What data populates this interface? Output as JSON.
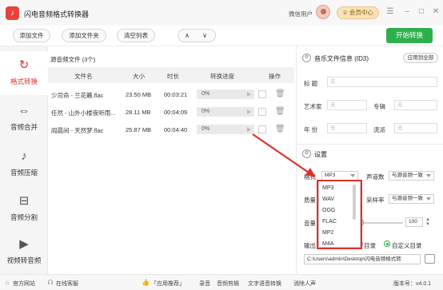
{
  "app": {
    "title": "闪电音频格式转换器",
    "logo_glyph": "♪"
  },
  "topbar": {
    "user_label": "微信用户",
    "vip_label": "会员中心",
    "window_icons": [
      "menu-icon",
      "minimize-icon",
      "maximize-icon",
      "close-icon"
    ]
  },
  "toolbar": {
    "add_file": "添加文件",
    "add_folder": "添加文件夹",
    "clear_list": "清空列表",
    "up": "∧",
    "down": "∨",
    "start": "开始转换"
  },
  "sidebar": {
    "items": [
      {
        "label": "格式转换",
        "icon": "refresh-icon",
        "glyph": "↻",
        "active": true
      },
      {
        "label": "音频合并",
        "icon": "merge-icon",
        "glyph": "⇔",
        "active": false
      },
      {
        "label": "音频压缩",
        "icon": "music-note-icon",
        "glyph": "♪",
        "active": false
      },
      {
        "label": "音频分割",
        "icon": "split-icon",
        "glyph": "⊟",
        "active": false
      },
      {
        "label": "视频转音频",
        "icon": "play-icon",
        "glyph": "▶",
        "active": false
      }
    ]
  },
  "files": {
    "title": "源音频文件 (3个)",
    "columns": [
      "文件名",
      "大小",
      "时长",
      "转换进度",
      "操作"
    ],
    "rows": [
      {
        "name": "少司命 - 兰花籁.flac",
        "size": "23.50 MB",
        "duration": "00:03:21",
        "progress": "0%"
      },
      {
        "name": "任然 - 山外小楼夜听雨...",
        "size": "28.11 MB",
        "duration": "00:04:09",
        "progress": "0%"
      },
      {
        "name": "阎晨间 - 天然梦.flac",
        "size": "25.87 MB",
        "duration": "00:04:40",
        "progress": "0%"
      }
    ]
  },
  "meta": {
    "title": "音乐文件信息 (ID3)",
    "apply_all": "应用到全部",
    "labels": {
      "title": "标  题",
      "artist": "艺术家",
      "album": "专辑",
      "year": "年  份",
      "genre": "流派"
    },
    "placeholder": "无"
  },
  "settings": {
    "title": "设置",
    "format_label": "格式",
    "format_value": "MP3",
    "channels_label": "声道数",
    "channels_value": "与源音频一致",
    "quality_label": "质量",
    "samplerate_label": "采样率",
    "samplerate_value": "与源音频一致",
    "volume_label": "音量",
    "volume_value": "100",
    "output_label": "输出目",
    "radio_source": "目录",
    "radio_custom": "自定义目录",
    "output_path": "C:\\Users\\admin\\Desktop\\闪电音频格式转"
  },
  "format_dropdown": [
    "MP3",
    "WAV",
    "OGG",
    "FLAC",
    "MP2",
    "M4A"
  ],
  "statusbar": {
    "site": "官方网站",
    "support": "在线客服",
    "recommend": "「应用推荐」",
    "items": [
      "录音",
      "音频剪辑",
      "文字语音转换",
      "消除人声"
    ],
    "version": "版本号：v4.0.1"
  },
  "colors": {
    "accent_red": "#e0302a",
    "start_green": "#2eaf4d"
  }
}
